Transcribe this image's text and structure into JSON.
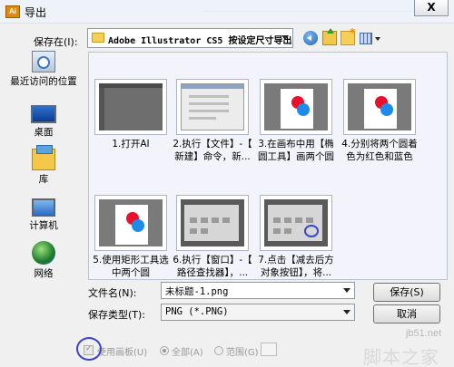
{
  "window": {
    "title": "导出",
    "app_icon_text": "Ai",
    "close_glyph": "X"
  },
  "toolbar": {
    "save_in_label": "保存在(I):",
    "current_path": "Adobe Illustrator CS5 按设定尺寸导出",
    "icons": [
      "back-icon",
      "up-folder-icon",
      "new-folder-icon",
      "view-menu-icon"
    ]
  },
  "places": [
    {
      "label": "最近访问的位置",
      "icon": "recent-places-icon"
    },
    {
      "label": "桌面",
      "icon": "desktop-icon"
    },
    {
      "label": "库",
      "icon": "library-icon"
    },
    {
      "label": "计算机",
      "icon": "computer-icon"
    },
    {
      "label": "网络",
      "icon": "network-icon"
    }
  ],
  "files": [
    {
      "caption1": "1.打开AI",
      "caption2": ""
    },
    {
      "caption1": "2.执行【文件】-【",
      "caption2": "新建】命令，新..."
    },
    {
      "caption1": "3.在画布中用【椭",
      "caption2": "圆工具】画两个圆"
    },
    {
      "caption1": "4.分别将两个圆着",
      "caption2": "色为红色和蓝色"
    },
    {
      "caption1": "5.使用矩形工具选",
      "caption2": "中两个圆"
    },
    {
      "caption1": "6.执行【窗口】-【",
      "caption2": "路径查找器】，..."
    },
    {
      "caption1": "7.点击【减去后方",
      "caption2": "对象按钮】，将..."
    }
  ],
  "form": {
    "filename_label": "文件名(N):",
    "filename_value": "未标题-1.png",
    "type_label": "保存类型(T):",
    "type_value": "PNG (*.PNG)",
    "save_button": "保存(S)",
    "cancel_button": "取消"
  },
  "options": {
    "use_artboards_label": "使用画板(U)",
    "all_label": "全部(A)",
    "range_label": "范围(G)"
  },
  "watermark": {
    "url": "jb51.net",
    "text": "脚本之家"
  }
}
